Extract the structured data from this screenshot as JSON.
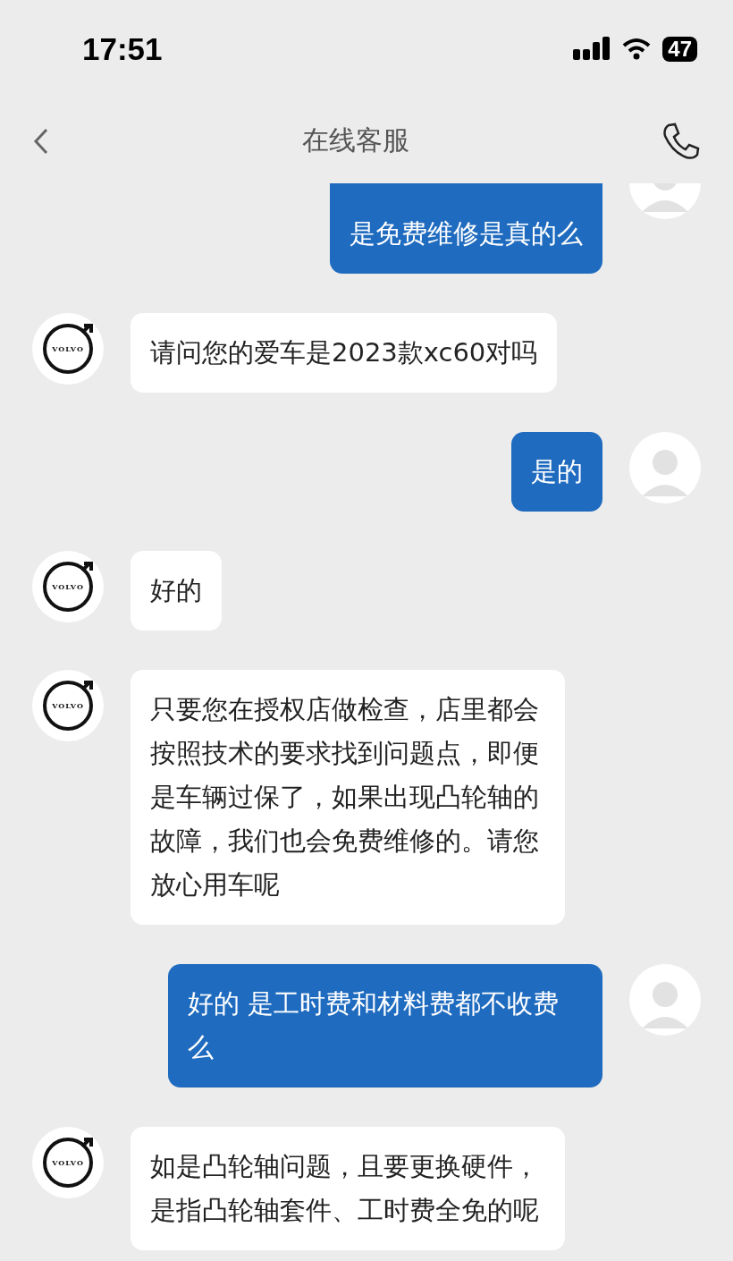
{
  "status_bar": {
    "time": "17:51",
    "battery": "47"
  },
  "header": {
    "title": "在线客服"
  },
  "messages": [
    {
      "kind": "outgoing",
      "text": "是免费维修是真的么",
      "clipped": true
    },
    {
      "kind": "incoming",
      "avatar_label": "VOLVO",
      "text": "请问您的爱车是2023款xc60对吗"
    },
    {
      "kind": "outgoing",
      "text": "是的",
      "clipped": false
    },
    {
      "kind": "incoming",
      "avatar_label": "VOLVO",
      "text": "好的"
    },
    {
      "kind": "incoming",
      "avatar_label": "VOLVO",
      "text": "只要您在授权店做检查，店里都会按照技术的要求找到问题点，即便是车辆过保了，如果出现凸轮轴的故障，我们也会免费维修的。请您放心用车呢"
    },
    {
      "kind": "outgoing",
      "text": "好的 是工时费和材料费都不收费么",
      "clipped": false
    },
    {
      "kind": "incoming",
      "avatar_label": "VOLVO",
      "text": "如是凸轮轴问题，且要更换硬件，是指凸轮轴套件、工时费全免的呢"
    }
  ]
}
